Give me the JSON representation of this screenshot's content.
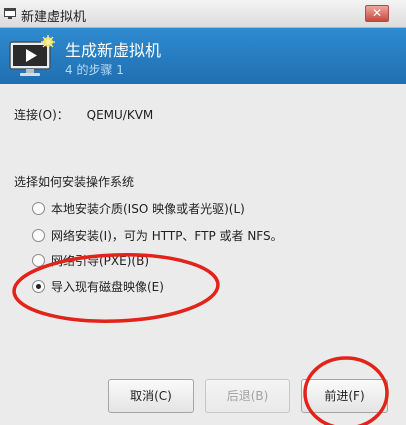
{
  "window": {
    "title": "新建虚拟机",
    "close_label": "✕"
  },
  "banner": {
    "heading": "生成新虚拟机",
    "step": "4 的步骤 1"
  },
  "connection": {
    "label": "连接(O)：",
    "value": "QEMU/KVM"
  },
  "install": {
    "question": "选择如何安装操作系统",
    "options": [
      {
        "label": "本地安装介质(ISO 映像或者光驱)(L)",
        "selected": false
      },
      {
        "label": "网络安装(I)，可为 HTTP、FTP 或者 NFS。",
        "selected": false
      },
      {
        "label": "网络引导(PXE)(B)",
        "selected": false
      },
      {
        "label": "导入现有磁盘映像(E)",
        "selected": true
      }
    ]
  },
  "buttons": {
    "cancel": "取消(C)",
    "back": "后退(B)",
    "forward": "前进(F)"
  },
  "colors": {
    "banner": "#2a80c4",
    "annotation": "#e2231a"
  },
  "icons": {
    "app": "window-icon",
    "banner": "monitor-play-icon",
    "close": "close-icon"
  }
}
